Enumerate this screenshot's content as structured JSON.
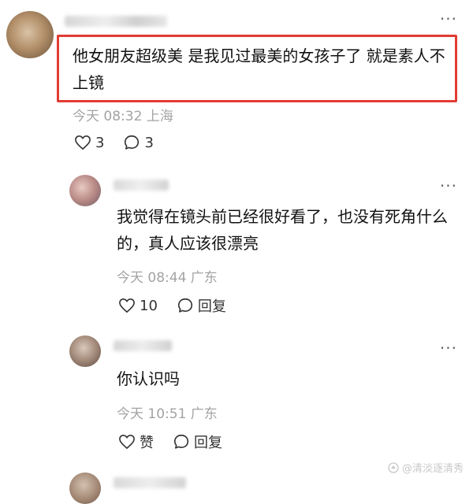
{
  "comments": [
    {
      "text": "他女朋友超级美 是我见过最美的女孩子了 就是素人不上镜",
      "time": "今天 08:32 上海",
      "likes": "3",
      "replies": "3"
    },
    {
      "text": "我觉得在镜头前已经很好看了，也没有死角什么的，真人应该很漂亮",
      "time": "今天 08:44 广东",
      "likes": "10",
      "reply_label": "回复"
    },
    {
      "text": "你认识吗",
      "time": "今天 10:51 广东",
      "like_label": "赞",
      "reply_label": "回复"
    }
  ],
  "more_label": "···",
  "watermark": "@清淡逐清秀",
  "colors": {
    "highlight": "#e23b32",
    "meta": "#a3a3a3"
  },
  "icons": {
    "like": "heart-icon",
    "reply": "speech-bubble-icon",
    "more": "more-dots-icon"
  }
}
